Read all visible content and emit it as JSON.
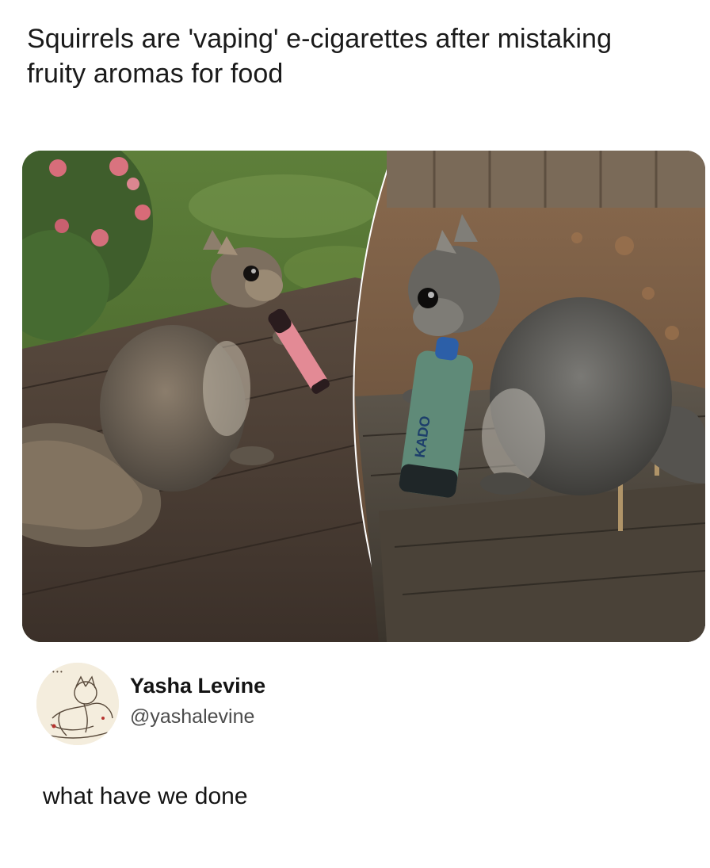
{
  "headline": "Squirrels are 'vaping' e-cigarettes after mistaking fruity aromas for food",
  "photos": {
    "left_alt_icon": "squirrel-with-pink-vape-photo",
    "right_alt_icon": "squirrel-with-green-vape-photo",
    "vape_brand_text": "KADO"
  },
  "tweet": {
    "author_name": "Yasha Levine",
    "author_handle": "@yashalevine",
    "body": "what have we done"
  }
}
